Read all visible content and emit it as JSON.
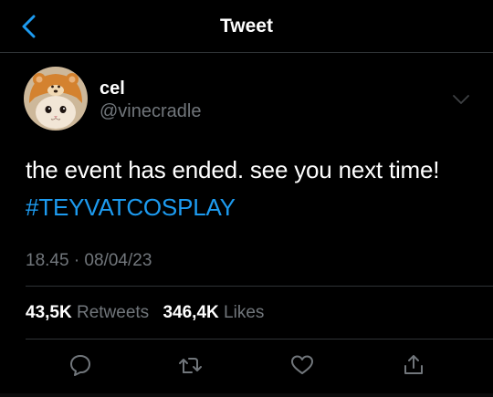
{
  "header": {
    "title": "Tweet",
    "back_icon": "chevron-left-icon"
  },
  "author": {
    "display_name": "cel",
    "handle": "@vinecradle",
    "avatar": "cat-in-bear-hat-avatar"
  },
  "tweet": {
    "text": "the event has ended. see you next time! ",
    "hashtag": "#TEYVATCOSPLAY",
    "timestamp": "18.45 · 08/04/23"
  },
  "stats": {
    "retweets_count": "43,5K",
    "retweets_label": "Retweets",
    "likes_count": "346,4K",
    "likes_label": "Likes"
  },
  "actions": [
    "reply-icon",
    "retweet-icon",
    "like-icon",
    "share-icon"
  ],
  "colors": {
    "background": "#000000",
    "accent": "#1d9bf0",
    "muted": "#71767b",
    "divider": "#2f3336"
  }
}
